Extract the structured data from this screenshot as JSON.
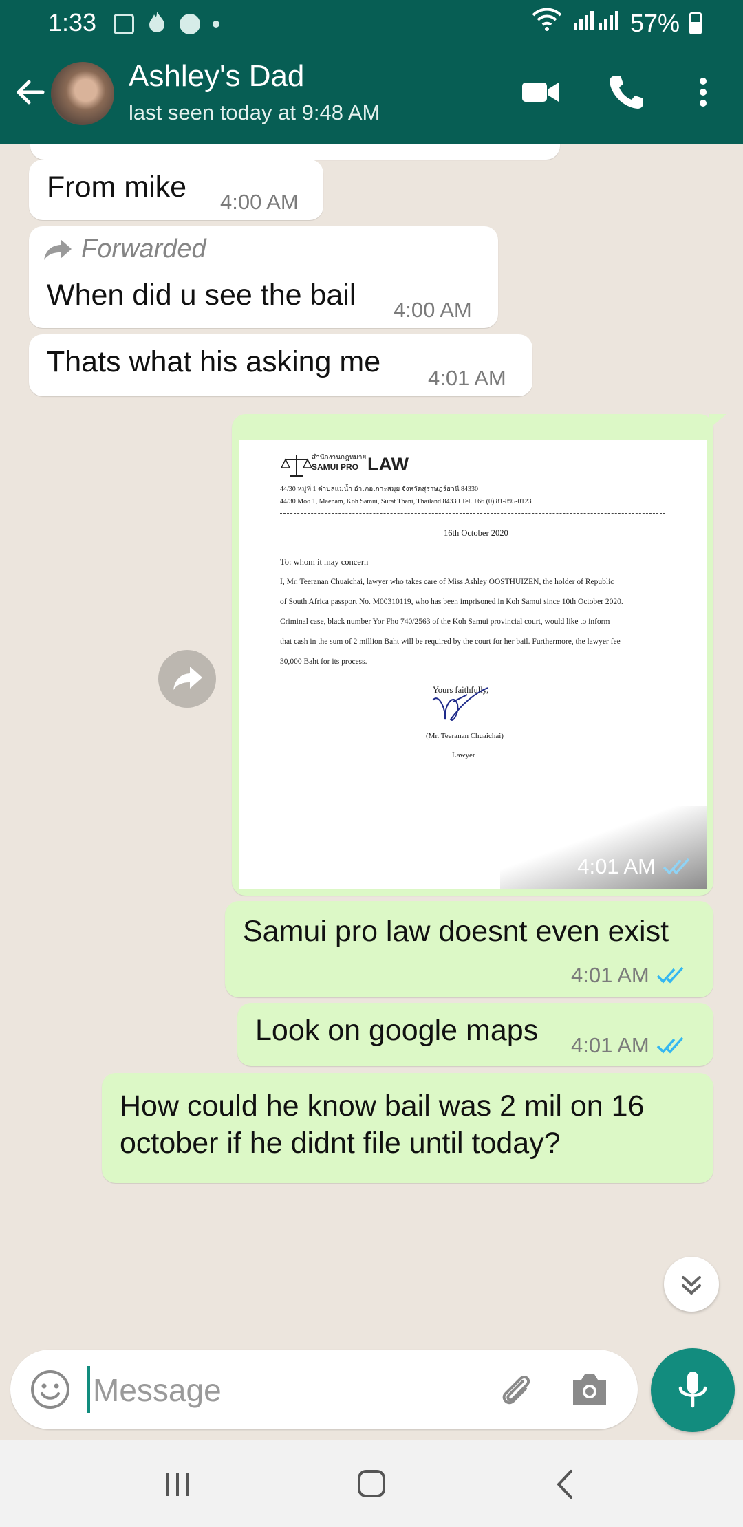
{
  "status_bar": {
    "time": "1:33",
    "battery": "57%",
    "icons": [
      "gallery-icon",
      "fire-icon",
      "account-icon",
      "dot-icon",
      "wifi-icon",
      "signal-icon",
      "battery-icon"
    ]
  },
  "header": {
    "contact_name": "Ashley's Dad",
    "last_seen": "last seen today at 9:48 AM",
    "icons": [
      "back-arrow-icon",
      "video-call-icon",
      "voice-call-icon",
      "more-options-icon"
    ]
  },
  "messages": [
    {
      "direction": "in",
      "text": "From mike",
      "time": "4:00 AM"
    },
    {
      "direction": "in",
      "forwarded_label": "Forwarded",
      "text": "When did u see the bail",
      "time": "4:00 AM"
    },
    {
      "direction": "in",
      "text": "Thats what his asking me",
      "time": "4:01 AM"
    },
    {
      "direction": "out",
      "type": "image",
      "time": "4:01 AM",
      "status": "read"
    },
    {
      "direction": "out",
      "text": "Samui pro law doesnt even exist",
      "time": "4:01 AM",
      "status": "read"
    },
    {
      "direction": "out",
      "text": "Look on google maps",
      "time": "4:01 AM",
      "status": "read"
    },
    {
      "direction": "out",
      "text_line1": "How could he know bail was 2 mil on 16",
      "text_line2": "october if he didnt file until today?"
    }
  ],
  "document": {
    "firm_thai": "สำนักงานกฎหมาย",
    "firm_name_small": "SAMUI PRO",
    "firm_name_big": "LAW",
    "address_thai": "44/30 หมู่ที่ 1 ตำบลแม่น้ำ อำเภอเกาะสมุย จังหวัดสุราษฎร์ธานี 84330",
    "address_en": "44/30 Moo 1,  Maenam,  Koh Samui,  Surat Thani,  Thailand  84330  Tel.  +66 (0) 81-895-0123",
    "date": "16th October 2020",
    "salutation": "To: whom it may concern",
    "body": [
      "I, Mr. Teeranan Chuaichai, lawyer who takes care of Miss Ashley OOSTHUIZEN, the holder of Republic",
      "of South Africa passport No. M00310119, who has been imprisoned in Koh Samui since 10th October 2020.",
      "Criminal case, black number Yor Fho 740/2563 of the Koh Samui provincial court, would like to inform",
      "that cash in the sum of 2 million Baht will be required by the court for her bail. Furthermore, the lawyer fee",
      "30,000 Baht for its process."
    ],
    "closing": "Yours faithfully,",
    "signatory": "(Mr. Teeranan Chuaichai)",
    "title": "Lawyer"
  },
  "composer": {
    "placeholder": "Message",
    "icons": [
      "emoji-icon",
      "attach-icon",
      "camera-icon",
      "mic-icon"
    ]
  },
  "colors": {
    "header": "#075e54",
    "accent": "#128c7e",
    "incoming_bubble": "#ffffff",
    "outgoing_bubble": "#dcf8c6",
    "read_tick": "#34b7f1",
    "chat_background": "#ece5dd"
  }
}
